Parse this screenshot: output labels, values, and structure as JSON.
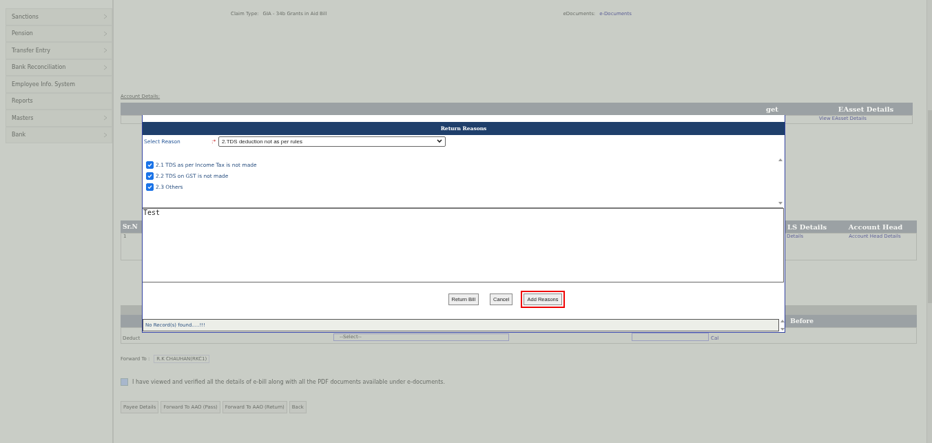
{
  "sidebar": {
    "items": [
      {
        "label": "Sanctions",
        "expandable": true
      },
      {
        "label": "Pension",
        "expandable": true
      },
      {
        "label": "Transfer Entry",
        "expandable": true
      },
      {
        "label": "Bank Reconciliation",
        "expandable": true
      },
      {
        "label": "Employee Info. System",
        "expandable": false
      },
      {
        "label": "Reports",
        "expandable": false
      },
      {
        "label": "Masters",
        "expandable": true
      },
      {
        "label": "Bank",
        "expandable": true
      }
    ]
  },
  "bill_header": {
    "claim_type_label": "Claim Type:",
    "claim_type": "GIA - 34b Grants in Aid Bill",
    "edocs_label": "eDocuments:",
    "edocs_link": "e-Documents"
  },
  "account_details": {
    "title": "Account Details:",
    "visible_header": "EAsset Details",
    "partial_header": "get",
    "cell": "View EAsset Details"
  },
  "annexure": {
    "headers": [
      "Sr.N",
      "LS Details",
      "Account Head"
    ],
    "cells": [
      "1",
      "Details",
      "Account Head Details"
    ]
  },
  "deductions": {
    "header": "Before",
    "cell": "Deduct",
    "select": "--Select--",
    "button": "Cal"
  },
  "forward": {
    "label": "Forward To :",
    "value": "R.K CHAUHAN(RKC1)"
  },
  "declaration": {
    "checked": true,
    "text": "I have viewed and verified all the details of e-bill along with all the PDF documents available under e-documents."
  },
  "page_buttons": [
    "Payee Details",
    "Forward To AAO (Pass)",
    "Forward To AAO (Return)",
    "Back"
  ],
  "modal": {
    "title": "Return Reasons",
    "select_label": "Select Reason",
    "required_mark": ":*",
    "select_value": "2.TDS deduction not as per rules",
    "reasons": [
      {
        "label": "2.1 TDS as per Income Tax is not made",
        "checked": true
      },
      {
        "label": "2.2 TDS on GST is not made",
        "checked": true
      },
      {
        "label": "2.3 Others",
        "checked": true
      }
    ],
    "remarks": "Test",
    "buttons": [
      {
        "label": "Return Bill",
        "highlighted": false
      },
      {
        "label": "Cancel",
        "highlighted": false
      },
      {
        "label": "Add Reasons",
        "highlighted": true
      }
    ],
    "footer": "No Record(s) found.....!!!"
  }
}
